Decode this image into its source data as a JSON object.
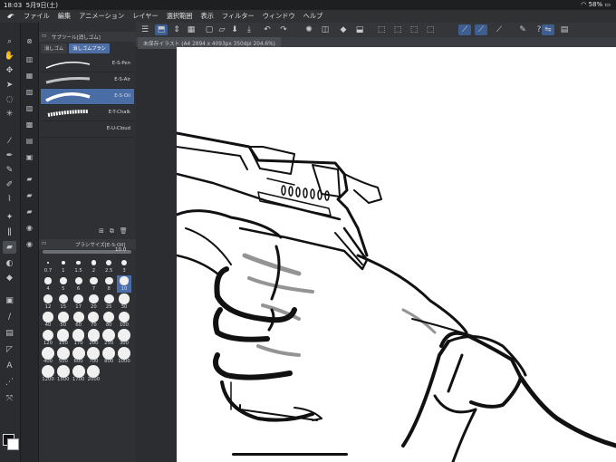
{
  "status_bar": {
    "time": "18:03",
    "date": "5月9日(土)",
    "battery": "58%"
  },
  "menu": {
    "items": [
      "ファイル",
      "編集",
      "アニメーション",
      "レイヤー",
      "選択範囲",
      "表示",
      "フィルター",
      "ウィンドウ",
      "ヘルプ"
    ]
  },
  "subtool_panel": {
    "header": "サブツール[消しゴム]",
    "tabs": [
      "消しゴム",
      "消しゴムブラシ"
    ],
    "brushes": [
      {
        "name": "E-S-Pen",
        "selected": false
      },
      {
        "name": "E-S-Air",
        "selected": false
      },
      {
        "name": "E-S-Oil",
        "selected": true
      },
      {
        "name": "E-T-Chalk",
        "selected": false
      },
      {
        "name": "E-U-Cloud",
        "selected": false
      }
    ]
  },
  "brush_size_panel": {
    "header": "ブラシサイズ[E-S-Oil]",
    "current_size": "10.0",
    "sizes": [
      "0.7",
      "1",
      "1.5",
      "2",
      "2.5",
      "3",
      "4",
      "5",
      "6",
      "7",
      "8",
      "10",
      "12",
      "15",
      "17",
      "20",
      "25",
      "30",
      "40",
      "50",
      "60",
      "70",
      "80",
      "100",
      "120",
      "150",
      "170",
      "200",
      "250",
      "300",
      "400",
      "500",
      "600",
      "700",
      "800",
      "1000",
      "1200",
      "1500",
      "1700",
      "2000"
    ],
    "selected_size": "10"
  },
  "canvas": {
    "tab_title": "未保存イラスト (A4 2894 x 4093px 350dpi 204.6%)"
  },
  "colors": {
    "foreground": "#111111",
    "background": "#ffffff",
    "accent": "#4a6da5"
  }
}
